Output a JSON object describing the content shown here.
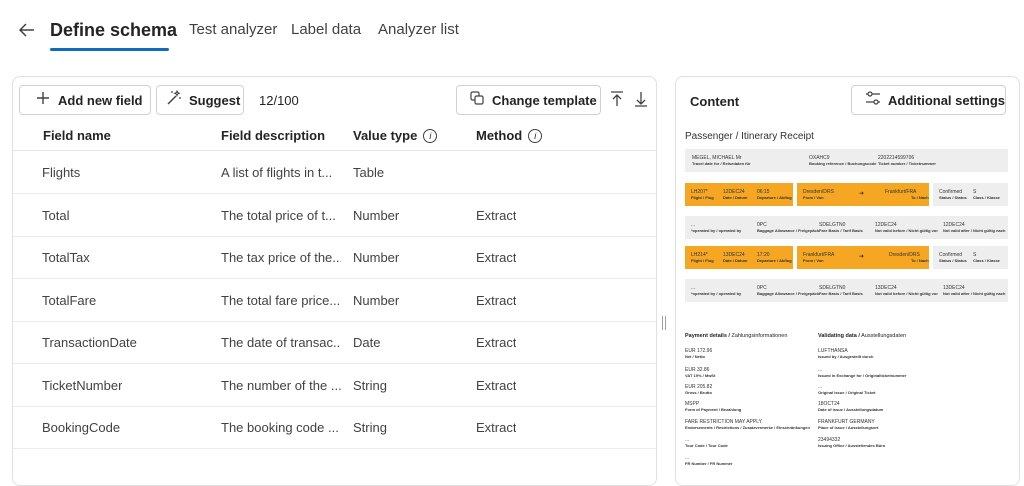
{
  "nav": {
    "tabs": [
      {
        "label": "Define schema",
        "active": true
      },
      {
        "label": "Test analyzer"
      },
      {
        "label": "Label data"
      },
      {
        "label": "Analyzer list"
      }
    ]
  },
  "toolbar": {
    "add_label": "Add new field",
    "suggest_label": "Suggest",
    "count": "12/100",
    "change_template_label": "Change template"
  },
  "table": {
    "headers": {
      "name": "Field name",
      "description": "Field description",
      "type": "Value type",
      "method": "Method"
    },
    "rows": [
      {
        "name": "Flights",
        "description": "A list of flights in t...",
        "type": "Table",
        "method": ""
      },
      {
        "name": "Total",
        "description": "The total price of t...",
        "type": "Number",
        "method": "Extract"
      },
      {
        "name": "TotalTax",
        "description": "The tax price of the...",
        "type": "Number",
        "method": "Extract"
      },
      {
        "name": "TotalFare",
        "description": "The total fare price...",
        "type": "Number",
        "method": "Extract"
      },
      {
        "name": "TransactionDate",
        "description": "The date of transac...",
        "type": "Date",
        "method": "Extract"
      },
      {
        "name": "TicketNumber",
        "description": "The number of the ...",
        "type": "String",
        "method": "Extract"
      },
      {
        "name": "BookingCode",
        "description": "The booking code ...",
        "type": "String",
        "method": "Extract"
      }
    ]
  },
  "content": {
    "title": "Content",
    "settings_label": "Additional settings",
    "doc": {
      "title": "Passenger / Itinerary Receipt",
      "s1": {
        "name": "MEGEL, MICHAEL Mr",
        "name_l": "Travel date for / Reisedaten für",
        "booking": "OXAHC9",
        "booking_l": "Booking reference / Buchungscode",
        "ticket": "2202214599706",
        "ticket_l": "Ticket number / Ticketnummer"
      },
      "f1": {
        "flight": "LH207*",
        "flight_l": "Flight / Flug",
        "date": "12DEC24",
        "date_l": "Date / Datum",
        "dep": "06:15",
        "dep_l": "Departure / Abflug",
        "from": "Dresden/DRS",
        "from_l": "From / Von",
        "to": "Frankfurt/FRA",
        "to_l": "To / Nach",
        "status": "Confirmed",
        "status_l": "Status / Status",
        "class": "S",
        "class_l": "Class / Klasse"
      },
      "i1": {
        "op": "...",
        "op_l": "*operated by / operated by",
        "bag": "0PC",
        "bag_l": "Baggage Allowance / Freigepäck",
        "fare": "SDELGTN0",
        "fare_l": "Fare Basis / Tarif Basis",
        "nvb": "12DEC24",
        "nvb_l": "Not valid before / Nicht gültig vor",
        "nva": "12DEC24",
        "nva_l": "Not valid after / Nicht gültig nach"
      },
      "f2": {
        "flight": "LH214*",
        "flight_l": "Flight / Flug",
        "date": "13DEC24",
        "date_l": "Date / Datum",
        "dep": "17:20",
        "dep_l": "Departure / Abflug",
        "from": "Frankfurt/FRA",
        "from_l": "From / Von",
        "to": "Dresden/DRS",
        "to_l": "To / Nach",
        "status": "Confirmed",
        "status_l": "Status / Status",
        "class": "S",
        "class_l": "Class / Klasse"
      },
      "i2": {
        "op": "...",
        "op_l": "*operated by / operated by",
        "bag": "0PC",
        "bag_l": "Baggage Allowance / Freigepäck",
        "fare": "SDELGTN0",
        "fare_l": "Fare Basis / Tarif Basis",
        "nvb": "13DEC24",
        "nvb_l": "Not valid before / Nicht gültig vor",
        "nva": "13DEC24",
        "nva_l": "Not valid after / Nicht gültig nach"
      },
      "pay_h_b": "Payment details /",
      "pay_h": "Zahlungsinformationen",
      "val_h_b": "Validating data /",
      "val_h": "Ausstellungsdaten",
      "pay": [
        {
          "v": "EUR 172.96",
          "l": "Net / Netto"
        },
        {
          "v": "EUR 32.86",
          "l": "VAT 19% / MwSt"
        },
        {
          "v": "EUR 205.82",
          "l": "Gross / Brutto"
        },
        {
          "v": "MSPP",
          "l": "Form of Payment / Bezahlung"
        },
        {
          "v": "FARE RESTRICTION MAY APPLY",
          "l": "Endorsements / Restrictions / Zusatzvermerke / Einschränkungen"
        },
        {
          "v": "...",
          "l": "Tour Code / Tour Code"
        },
        {
          "v": "...",
          "l": "FR Number / FR Nummer"
        }
      ],
      "val": [
        {
          "v": "LUFTHANSA",
          "l": "Issued by / Ausgestellt durch"
        },
        {
          "v": "...",
          "l": "Issued in Exchange for / Originalticketnummer"
        },
        {
          "v": "...",
          "l": "Original Issue / Original Ticket"
        },
        {
          "v": "18OCT24",
          "l": "Date of issue / Ausstellungsdatum"
        },
        {
          "v": "FRANKFURT GERMANY",
          "l": "Place of issue / Ausstellungsort"
        },
        {
          "v": "23494332",
          "l": "Issuing Office / Ausstellendes Büro"
        }
      ]
    }
  }
}
